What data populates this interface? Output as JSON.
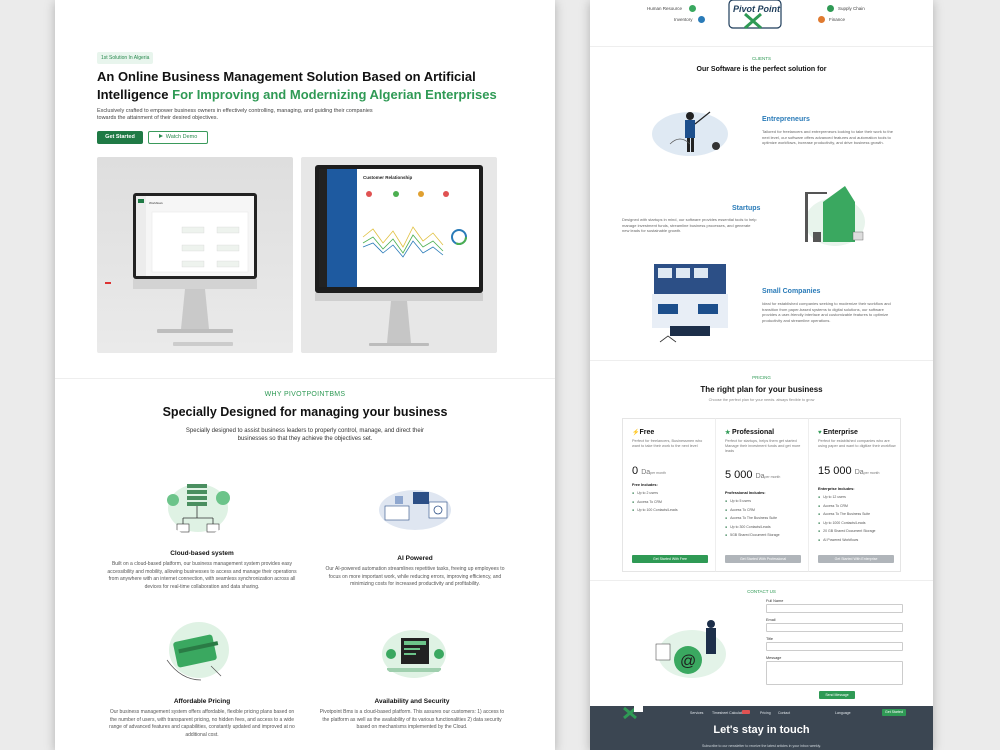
{
  "hero": {
    "badge": "1st Solution In Algeria",
    "title_line1": "An Online Business Management Solution Based on Artificial",
    "title_line2_prefix": "Intelligence ",
    "title_line2_green": "For Improving and Modernizing Algerian Enterprises",
    "subtitle": "Exclusively crafted to empower business owners in effectively controlling, managing, and guiding their companies towards the attainment of their desired objectives.",
    "btn_start": "Get Started",
    "btn_demo": "Watch Demo",
    "screen1_label": "Workflows",
    "screen2_label": "Customer Relationship"
  },
  "why": {
    "eyebrow": "WHY PIVOTPOINTBMS",
    "title": "Specially Designed for managing your business",
    "subtitle": "Specially designed to assist business leaders to properly control, manage, and direct their businesses so that they achieve the objectives set.",
    "features": [
      {
        "title": "Cloud-based system",
        "desc": "Built on a cloud-based platform, our business management system provides easy accessibility and mobility, allowing businesses to access and manage their operations from anywhere with an internet connection, with seamless synchronization across all devices for real-time collaboration and data sharing."
      },
      {
        "title": "AI Powered",
        "desc": "Our AI-powered automation streamlines repetitive tasks, freeing up employees to focus on more important work, while reducing errors, improving efficiency, and minimizing costs for increased productivity and profitability."
      },
      {
        "title": "Affordable Pricing",
        "desc": "Our business management system offers affordable, flexible pricing plans based on the number of users, with transparent pricing, no hidden fees, and access to a wide range of advanced features and capabilities, constantly updated and improved at no additional cost."
      },
      {
        "title": "Availability and Security",
        "desc": "Pivotpoint Bms is a cloud-based platform. This assures our customers: 1) access to the platform as well as the availability of its various functionalities 2) data security based on mechanisms implemented by the Cloud."
      }
    ]
  },
  "top_modules": {
    "human_resource": "Human Resource",
    "inventory": "Inventory",
    "supply_chain": "Supply Chain",
    "finance": "Finance",
    "logo_text": "Pivot Point"
  },
  "clients": {
    "eyebrow": "CLIENTS",
    "title": "Our Software is the perfect solution for",
    "items": [
      {
        "title": "Entrepreneurs",
        "desc": "Tailored for freelancers and entrepreneurs looking to take their work to the next level, our software offers advanced features and automation tools to optimize workflows, increase productivity, and drive business growth."
      },
      {
        "title": "Startups",
        "desc": "Designed with startups in mind, our software provides essential tools to help manage investment funds, streamline business processes, and generate new leads for sustainable growth."
      },
      {
        "title": "Small Companies",
        "desc": "Ideal for established companies seeking to modernize their workflow and transition from paper-based systems to digital solutions, our software provides a user-friendly interface and customizable features to optimize productivity and streamline operations."
      }
    ]
  },
  "pricing": {
    "eyebrow": "PRICING",
    "title": "The right plan for your business",
    "subtitle": "Choose the perfect plan for your needs. always flexible to grow",
    "plans": [
      {
        "name": "Free",
        "desc": "Perfect for freelancers, Businessmen who want to take their work to the next level",
        "price": "0",
        "unit": "Da",
        "per": "per month",
        "includes": "Free Includes:",
        "features": [
          "Up to 2 users",
          "Access To CRM",
          "Up to 100 Contacts/Leads"
        ],
        "cta": "Get Started With Free"
      },
      {
        "name": "Professional",
        "desc": "Perfect for startups, helps them get started Manage their investment funds and get more leads",
        "price": "5 000",
        "unit": "Da",
        "per": "per month",
        "includes": "Professional Includes:",
        "features": [
          "Up to 5 users",
          "Access To CRM",
          "Access To The Business Suite",
          "Up to 300 Contacts/Leads",
          "5GB Shared Document Storage"
        ],
        "cta": "Get Started With Professional"
      },
      {
        "name": "Enterprise",
        "desc": "Perfect for established companies who are using paper and want to digitize their workflow",
        "price": "15 000",
        "unit": "Da",
        "per": "per month",
        "includes": "Enterprise Includes:",
        "features": [
          "Up to 12 users",
          "Access To CRM",
          "Access To The Business Suite",
          "Up to 1000 Contacts/Leads",
          "20 GB Shared Document Storage",
          "AI Powered Workflows"
        ],
        "cta": "Get Started With Enterprise"
      }
    ]
  },
  "contact": {
    "eyebrow": "CONTACT US",
    "full_name": "Full Name",
    "email": "Email",
    "title": "Title",
    "message": "Message",
    "send": "Send Message"
  },
  "footer": {
    "nav": [
      "Services",
      "Timesheet Calculation",
      "Pricing",
      "Contact"
    ],
    "language": "Language",
    "cta": "Get Started",
    "title": "Let's stay in touch",
    "subtitle": "Subscribe to our newsletter to receive the latest articles in your inbox weekly."
  },
  "colors": {
    "brand_green": "#2f9a55",
    "dark_green": "#1f7a45",
    "client_blue": "#2a7bb8",
    "footer_bg": "#3b4652"
  }
}
